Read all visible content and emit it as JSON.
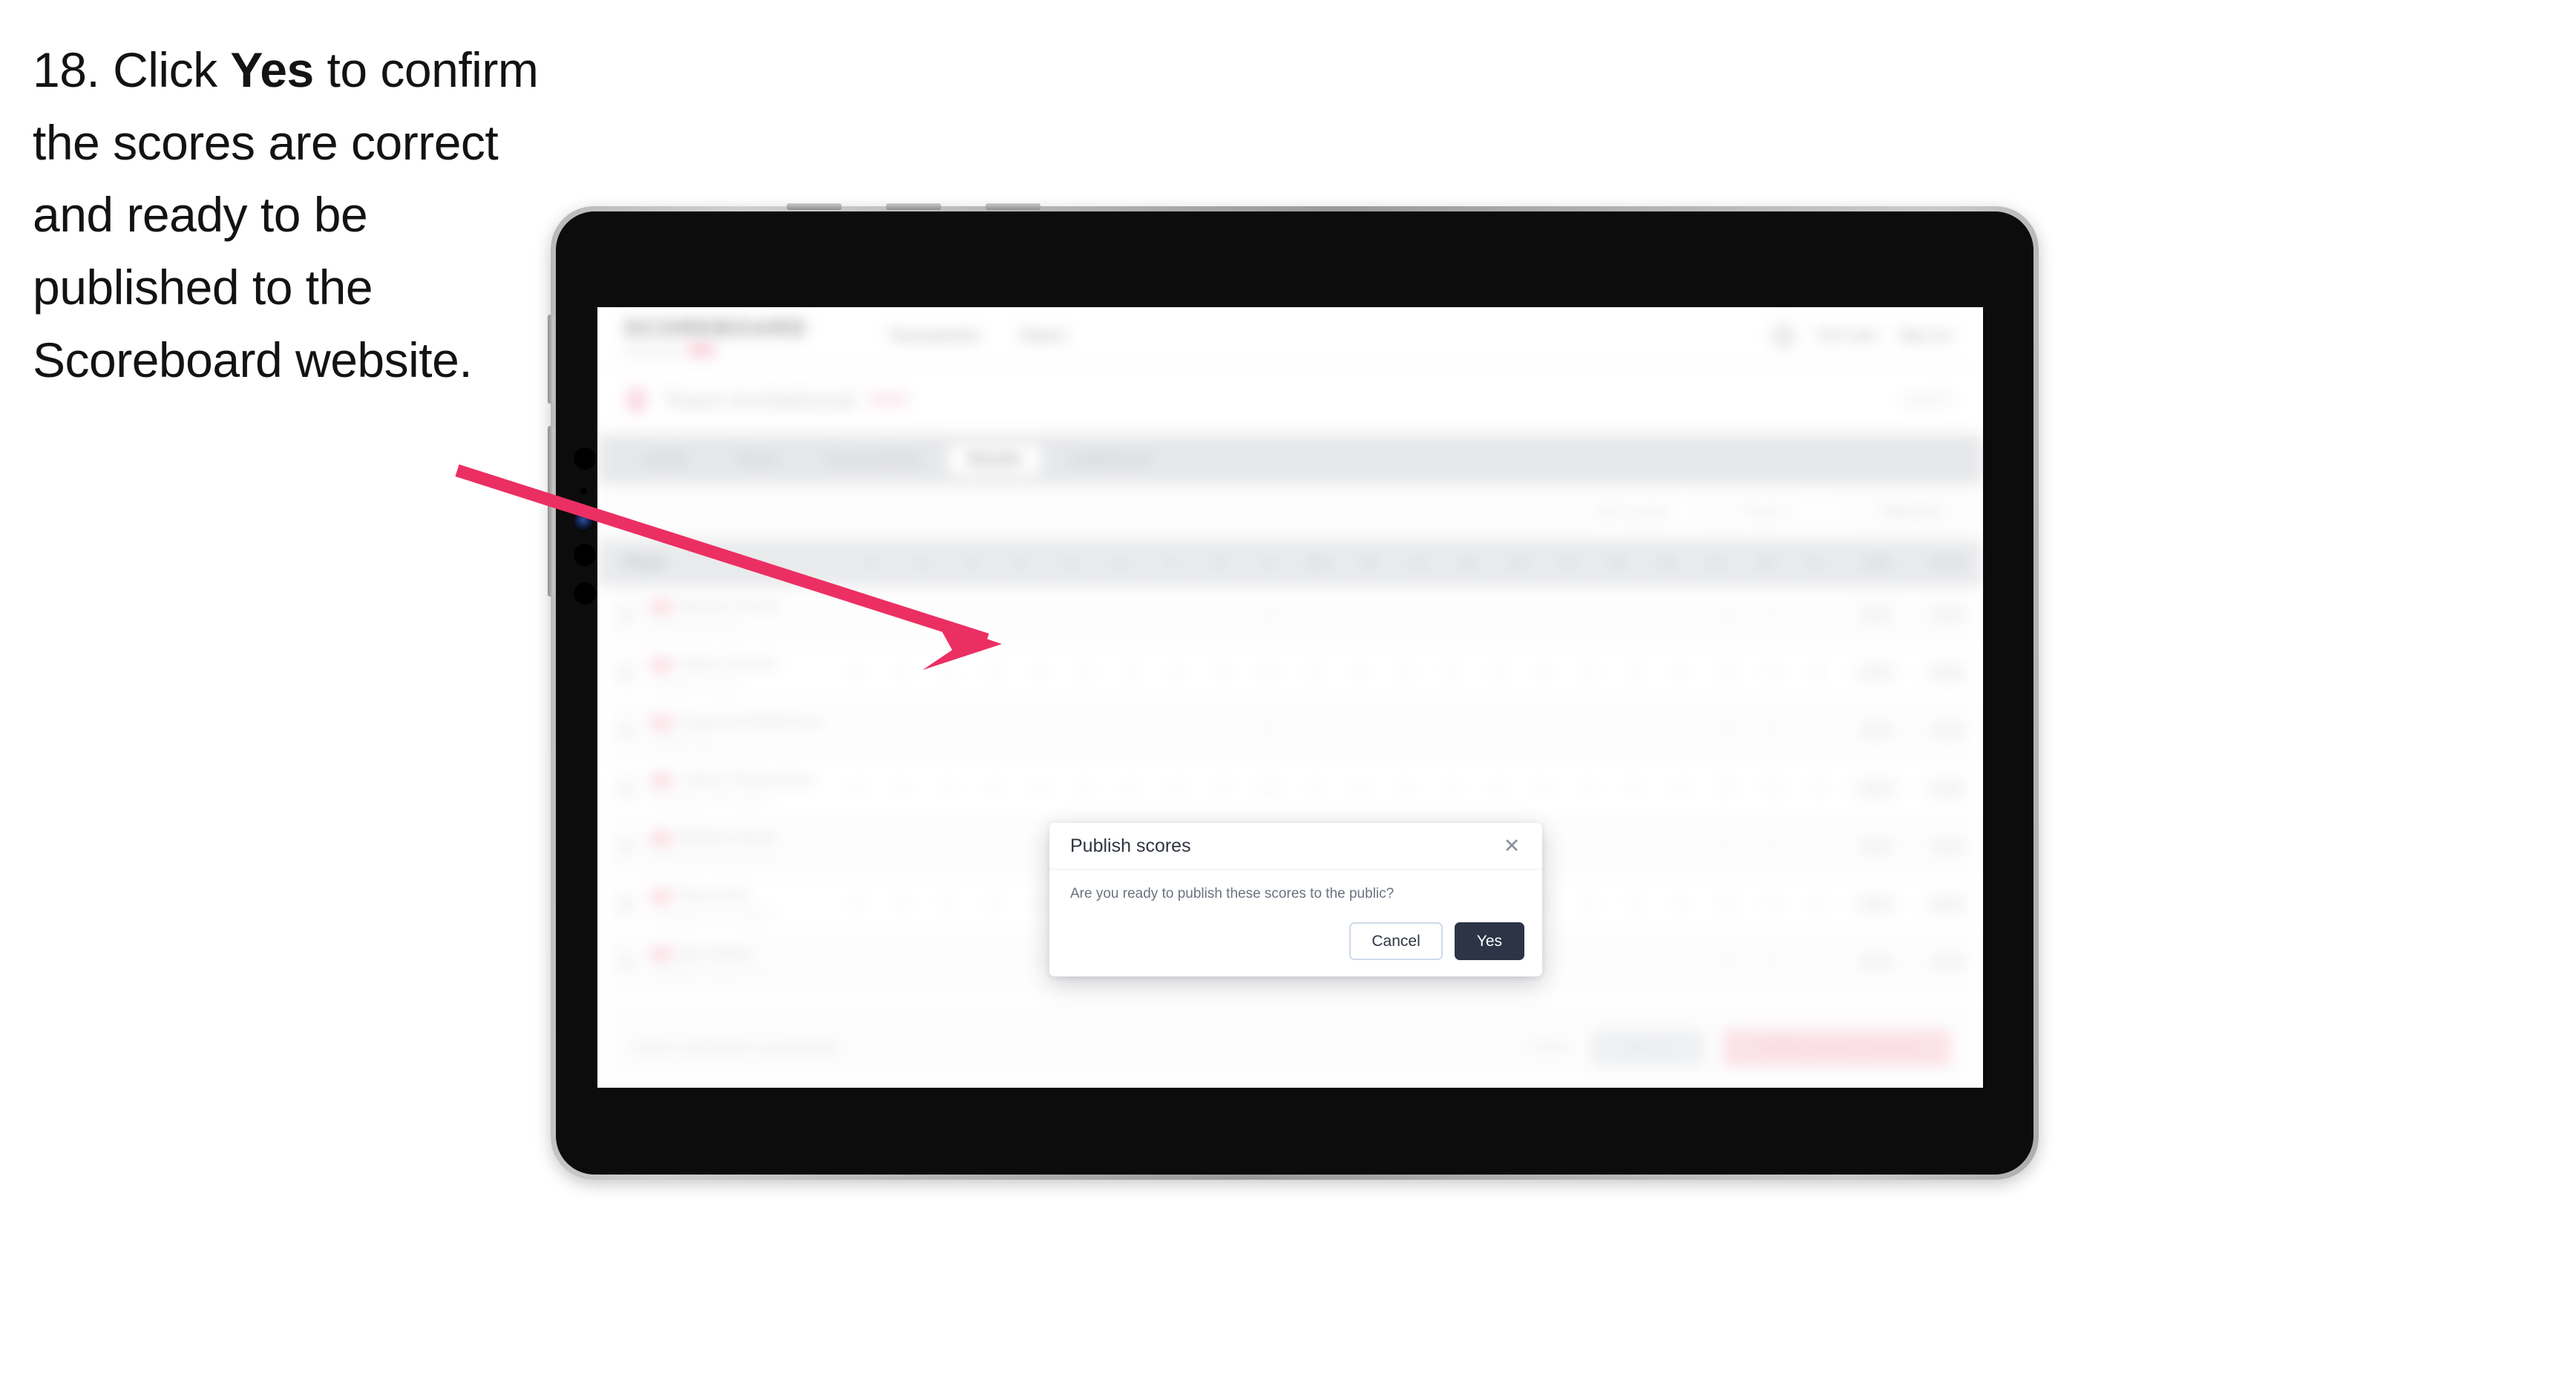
{
  "instruction": {
    "number": "18.",
    "part1": "Click ",
    "emphasis": "Yes",
    "part2": " to confirm the scores are correct and ready to be published to the Scoreboard website."
  },
  "annotation": {
    "arrow_color": "#ec2f63",
    "arrow_name": "pointer-arrow"
  },
  "device": {
    "name": "tablet",
    "frame_color": "#0c0c0c",
    "bezel_color": "#b9b9b9"
  },
  "app": {
    "header": {
      "brand_title": "SCOREBOARD",
      "brand_sub": "Tournaments",
      "brand_badge": "Beta",
      "nav": [
        {
          "label": "Tournaments"
        },
        {
          "label": "Teams"
        }
      ],
      "user_name": "Tom Liam",
      "sign_out": "Sign out",
      "avatar_icon": "avatar-icon"
    },
    "page": {
      "title": "Team Invitational",
      "chip": "2023",
      "right_label": "Level 3"
    },
    "tabs": [
      {
        "label": "Details",
        "active": false
      },
      {
        "label": "Teams",
        "active": false
      },
      {
        "label": "Courses/Holes",
        "active": false
      },
      {
        "label": "Results",
        "active": true
      },
      {
        "label": "Leaderboard",
        "active": false
      }
    ],
    "filters": {
      "search_placeholder": "Search",
      "filter_label": "Filter by team",
      "round_label": "Round 1",
      "sort_label": "Totals only",
      "kebab_icon": "kebab-menu-icon",
      "chevron_icon": "chevron-down-icon"
    },
    "table": {
      "columns": [
        "Player",
        "1",
        "2",
        "3",
        "4",
        "5",
        "6",
        "7",
        "8",
        "9",
        "Out",
        "10",
        "11",
        "12",
        "13",
        "14",
        "15",
        "16",
        "17",
        "18",
        "In",
        "Total",
        "Status"
      ],
      "rows": [
        {
          "player": "Marcus Turner",
          "club": "Eastern Golf Club",
          "scores": [
            "4",
            "3",
            "5",
            "4",
            "3",
            "4",
            "5",
            "4",
            "4",
            "36",
            "4",
            "3",
            "5",
            "4",
            "4",
            "3",
            "5",
            "4",
            "4",
            "36"
          ],
          "total": "72",
          "par": "E",
          "status_a": "OK",
          "status_b": "Sub"
        },
        {
          "player": "Oliver Parnell",
          "club": "Lakeview Country",
          "scores": [
            "5",
            "4",
            "4",
            "3",
            "4",
            "5",
            "4",
            "3",
            "5",
            "37",
            "4",
            "4",
            "4",
            "5",
            "3",
            "4",
            "4",
            "4",
            "3",
            "35"
          ],
          "total": "72",
          "par": "E",
          "status_a": "OK",
          "status_b": "Sub"
        },
        {
          "player": "Cameron Robertson",
          "club": "Hillside Links",
          "scores": [
            "4",
            "4",
            "5",
            "4",
            "3",
            "4",
            "4",
            "5",
            "4",
            "37",
            "5",
            "4",
            "3",
            "4",
            "4",
            "5",
            "4",
            "3",
            "4",
            "36"
          ],
          "total": "73",
          "par": "+1",
          "status_a": "OK",
          "status_b": "Sub"
        },
        {
          "player": "Callum Richardson",
          "club": "Brookmoor Golf Society",
          "scores": [
            "4",
            "5",
            "4",
            "4",
            "4",
            "3",
            "5",
            "4",
            "5",
            "38",
            "4",
            "4",
            "5",
            "3",
            "4",
            "4",
            "4",
            "5",
            "4",
            "37"
          ],
          "total": "75",
          "par": "+3",
          "status_a": "OK",
          "status_b": "Sub"
        },
        {
          "player": "William Stuart",
          "club": "Glenmoor Park Golf Club",
          "scores": [
            "5",
            "4",
            "4",
            "5",
            "3",
            "4",
            "4",
            "4",
            "5",
            "38",
            "4",
            "5",
            "4",
            "4",
            "3",
            "5",
            "4",
            "4",
            "4",
            "37"
          ],
          "total": "75",
          "par": "+3",
          "status_a": "OK",
          "status_b": "Sub"
        },
        {
          "player": "Ryan Kirk",
          "club": "Northgate Golf Academy",
          "scores": [
            "4",
            "4",
            "5",
            "4",
            "4",
            "4",
            "5",
            "4",
            "4",
            "38",
            "5",
            "4",
            "4",
            "4",
            "4",
            "4",
            "5",
            "4",
            "4",
            "38"
          ],
          "total": "76",
          "par": "+4",
          "status_a": "OK",
          "status_b": "Sub"
        },
        {
          "player": "Ben Bailey",
          "club": "Westfield Country Club",
          "scores": [
            "5",
            "4",
            "5",
            "4",
            "4",
            "5",
            "4",
            "4",
            "5",
            "40",
            "4",
            "5",
            "4",
            "5",
            "4",
            "4",
            "4",
            "5",
            "4",
            "39"
          ],
          "total": "79",
          "par": "+7",
          "status_a": "OK",
          "status_b": "Sub"
        }
      ]
    },
    "footer": {
      "note": "Scores published successfully",
      "link_label": "Cancel",
      "grey_button": "Save all",
      "pink_button": "Publish results to website"
    }
  },
  "modal": {
    "title": "Publish scores",
    "message": "Are you ready to publish these scores to the public?",
    "cancel_label": "Cancel",
    "confirm_label": "Yes",
    "close_icon": "close-icon",
    "confirm_color": "#2c3446"
  }
}
